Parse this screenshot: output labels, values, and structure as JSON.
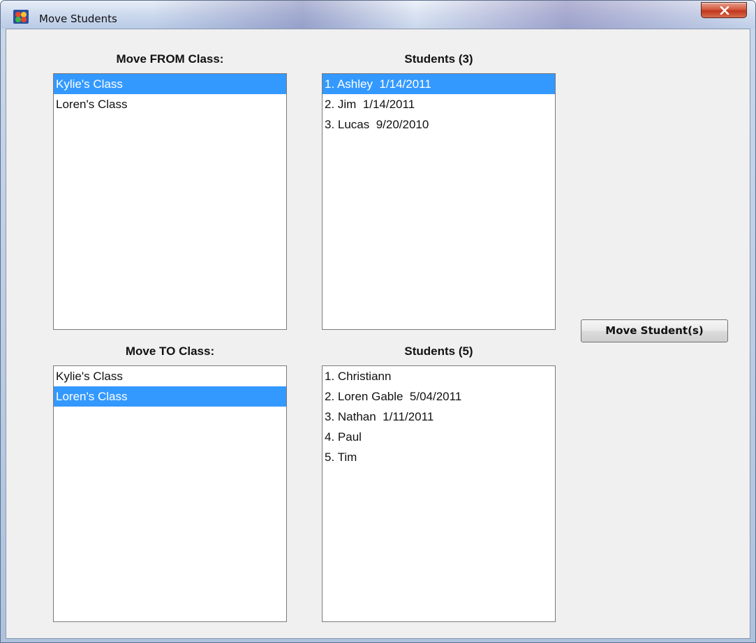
{
  "window": {
    "title": "Move Students"
  },
  "from_class": {
    "title": "Move FROM Class:",
    "items": [
      {
        "label": "Kylie's Class",
        "selected": true
      },
      {
        "label": "Loren's Class",
        "selected": false
      }
    ]
  },
  "from_students": {
    "title": "Students (3)",
    "items": [
      {
        "label": "1. Ashley  1/14/2011",
        "selected": true
      },
      {
        "label": "2. Jim  1/14/2011",
        "selected": false
      },
      {
        "label": "3. Lucas  9/20/2010",
        "selected": false
      }
    ]
  },
  "to_class": {
    "title": "Move TO Class:",
    "items": [
      {
        "label": "Kylie's Class",
        "selected": false
      },
      {
        "label": "Loren's Class",
        "selected": true
      }
    ]
  },
  "to_students": {
    "title": "Students (5)",
    "items": [
      {
        "label": "1. Christiann",
        "selected": false
      },
      {
        "label": "2. Loren Gable  5/04/2011",
        "selected": false
      },
      {
        "label": "3. Nathan  1/11/2011",
        "selected": false
      },
      {
        "label": "4. Paul",
        "selected": false
      },
      {
        "label": "5. Tim",
        "selected": false
      }
    ]
  },
  "actions": {
    "move_label": "Move Student(s)"
  },
  "colors": {
    "selection": "#3399ff",
    "client_background": "#f0f0f0",
    "close_button": "#c0381e"
  },
  "icons": {
    "app": "app-icon",
    "close": "close-icon"
  }
}
